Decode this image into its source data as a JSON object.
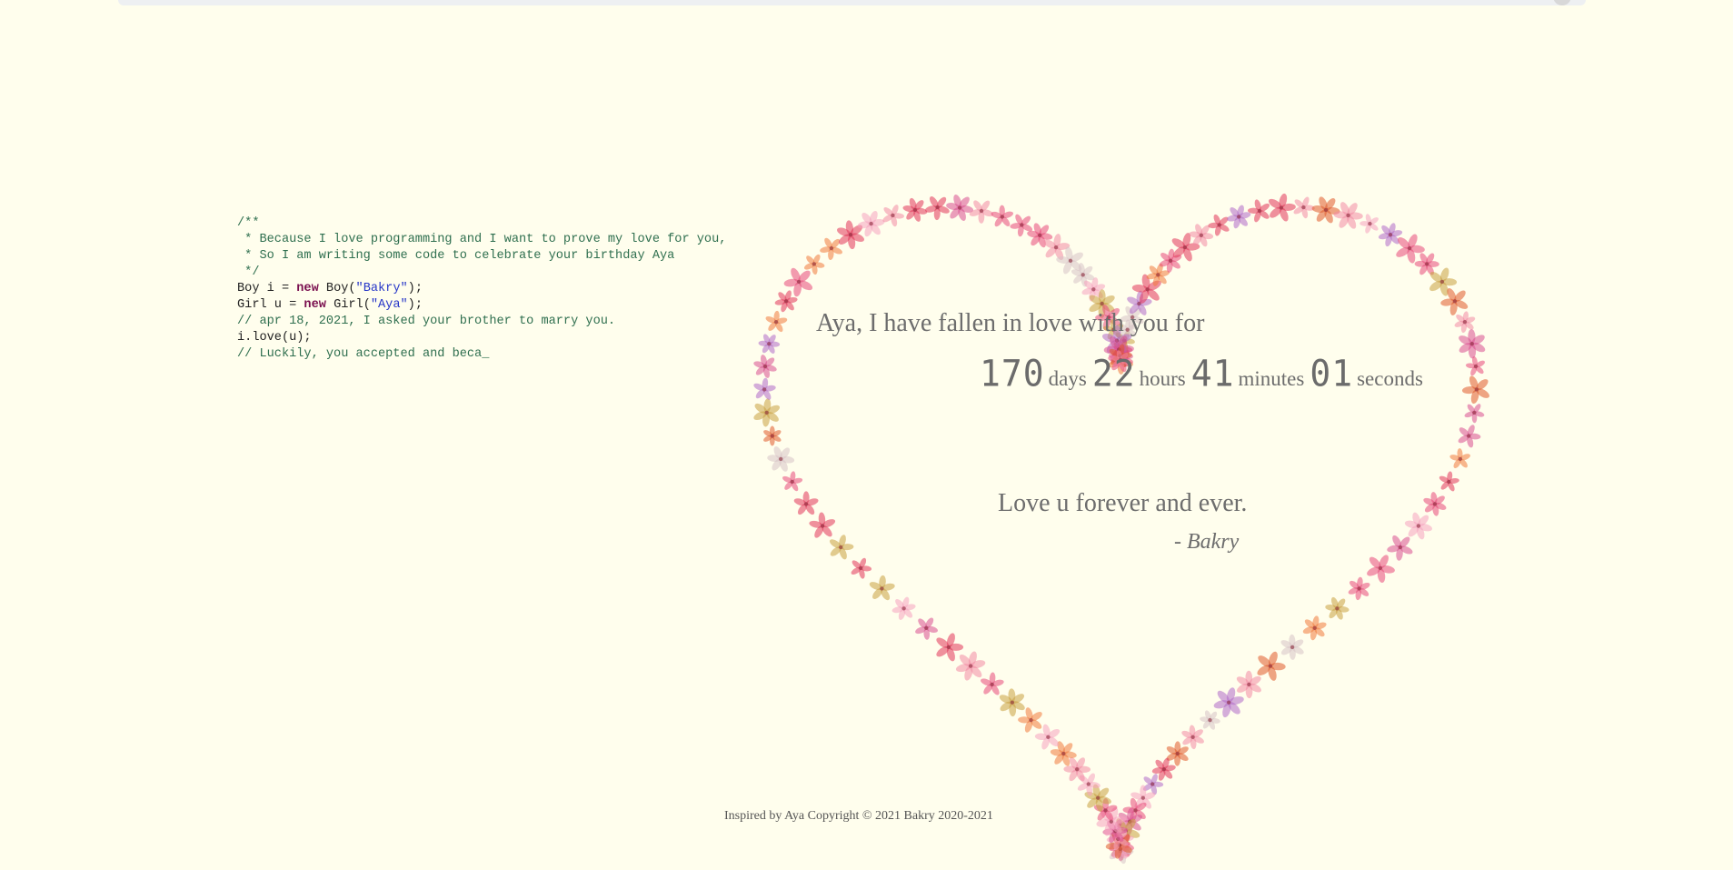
{
  "code": {
    "lines": [
      [
        {
          "t": "/**",
          "k": "comment"
        }
      ],
      [
        {
          "t": " * Because I love programming and I want to prove my love for you,",
          "k": "comment"
        }
      ],
      [
        {
          "t": " * So I am writing some code to celebrate your birthday Aya",
          "k": "comment"
        }
      ],
      [
        {
          "t": " */",
          "k": "comment"
        }
      ],
      [
        {
          "t": "Boy i = ",
          "k": "plain"
        },
        {
          "t": "new",
          "k": "keyword"
        },
        {
          "t": " Boy(",
          "k": "plain"
        },
        {
          "t": "\"Bakry\"",
          "k": "string"
        },
        {
          "t": ");",
          "k": "plain"
        }
      ],
      [
        {
          "t": "Girl u = ",
          "k": "plain"
        },
        {
          "t": "new",
          "k": "keyword"
        },
        {
          "t": " Girl(",
          "k": "plain"
        },
        {
          "t": "\"Aya\"",
          "k": "string"
        },
        {
          "t": ");",
          "k": "plain"
        }
      ],
      [
        {
          "t": "// apr 18, 2021, I asked your brother to marry you.",
          "k": "comment"
        }
      ],
      [
        {
          "t": "i.love(u);",
          "k": "plain"
        }
      ],
      [
        {
          "t": "// Luckily, you accepted and beca_",
          "k": "comment"
        }
      ]
    ]
  },
  "heart": {
    "message": "Aya, I have fallen in love with you for",
    "timer": {
      "days": "170",
      "days_label": "days",
      "hours": "22",
      "hours_label": "hours",
      "minutes": "41",
      "minutes_label": "minutes",
      "seconds": "01",
      "seconds_label": "seconds"
    },
    "closing": "Love u forever and ever.",
    "signature": "- Bakry",
    "flower_colors": [
      "#e8487a",
      "#f07a3c",
      "#d94e8f",
      "#f5a2c0",
      "#e2345a",
      "#c9a040",
      "#b06ac9",
      "#f28aa4",
      "#e05a2a",
      "#d7c2c7"
    ]
  },
  "footer": {
    "text": "Inspired by Aya Copyright © 2021 Bakry 2020-2021"
  }
}
